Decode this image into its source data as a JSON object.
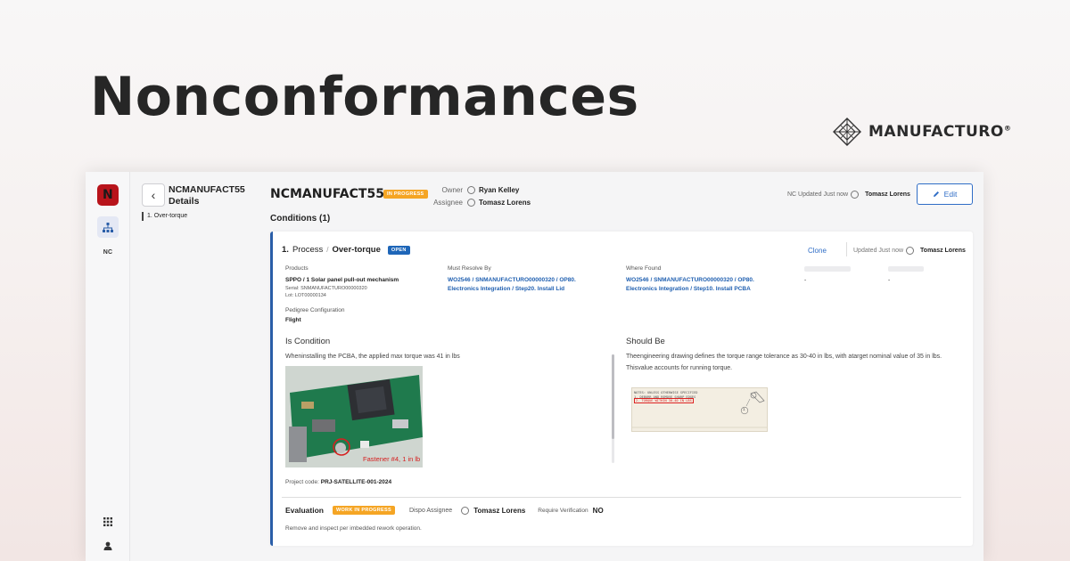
{
  "hero": {
    "title": "Nonconformances",
    "brand": "MANUFACTURO",
    "brand_mark": "®"
  },
  "rail": {
    "logo_letter": "N",
    "items": [
      {
        "icon": "hierarchy-icon"
      },
      {
        "icon": "nc-icon",
        "label": "NC"
      },
      {
        "icon": "apps-grid-icon"
      },
      {
        "icon": "user-icon"
      }
    ]
  },
  "sidebar": {
    "title": "NCMANUFACT55 Details",
    "items": [
      {
        "label": "1. Over-torque"
      }
    ]
  },
  "header": {
    "id": "NCMANUFACT55",
    "status": "IN PROGRESS",
    "owner_label": "Owner",
    "owner": "Ryan Kelley",
    "assignee_label": "Assignee",
    "assignee": "Tomasz Lorens",
    "updated": "NC Updated Just now",
    "updated_by": "Tomasz Lorens",
    "edit_label": "Edit",
    "colors": {
      "accent": "#2f6dc6",
      "status_orange": "#f5a524",
      "open_blue": "#1e66b8",
      "brand_red": "#b8141b"
    }
  },
  "conditions": {
    "title": "Conditions (1)",
    "card": {
      "number": "1.",
      "category": "Process",
      "separator": "/",
      "name": "Over-torque",
      "status": "OPEN",
      "clone_label": "Clone",
      "updated": "Updated Just now",
      "updated_by": "Tomasz Lorens",
      "products_label": "Products",
      "products_value": "SPPO / 1 Solar panel pull-out mechanism",
      "serial": "Serial: SNMANUFACTURO00000320",
      "lot": "Lot: LOT00000134",
      "must_resolve_label": "Must Resolve By",
      "must_resolve_value": "WO2546 / SNMANUFACTURO00000320 / OP80. Electronics Integration / Step20. Install Lid",
      "where_found_label": "Where Found",
      "where_found_value": "WO2546 / SNMANUFACTURO00000320 / OP80. Electronics Integration / Step10. Install PCBA",
      "extra_a": "-",
      "extra_b": "-",
      "pedigree_label": "Pedigree Configuration",
      "pedigree_value": "Flight",
      "is_condition_title": "Is Condition",
      "is_condition_text": "Wheninstalling the PCBA, the applied max torque was 41 in lbs",
      "photo_caption": "Fastener #4, 1 in lb",
      "should_be_title": "Should Be",
      "should_be_text": "Theengineering drawing defines the torque range tolerance as 30-40 in lbs, with atarget nominal value of 35 in lbs.  Thisvalue accounts for running torque.",
      "drawing_notes": [
        "NOTES: UNLESS OTHERWISE SPECIFIED",
        "1. DEBURR AND REMOVE SHARP EDGES",
        "2. TORQUE WITHIN 30-40 IN LBS"
      ],
      "drawing_callout": "1",
      "project_label": "Project code:",
      "project_code": "PRJ-SATELLITE-001-2024",
      "evaluation_title": "Evaluation",
      "evaluation_status": "WORK IN PROGRESS",
      "dispo_label": "Dispo Assignee",
      "dispo_assignee": "Tomasz Lorens",
      "verification_label": "Require Verification",
      "verification_value": "NO",
      "evaluation_note": "Remove and inspect per imbedded rework operation."
    }
  }
}
